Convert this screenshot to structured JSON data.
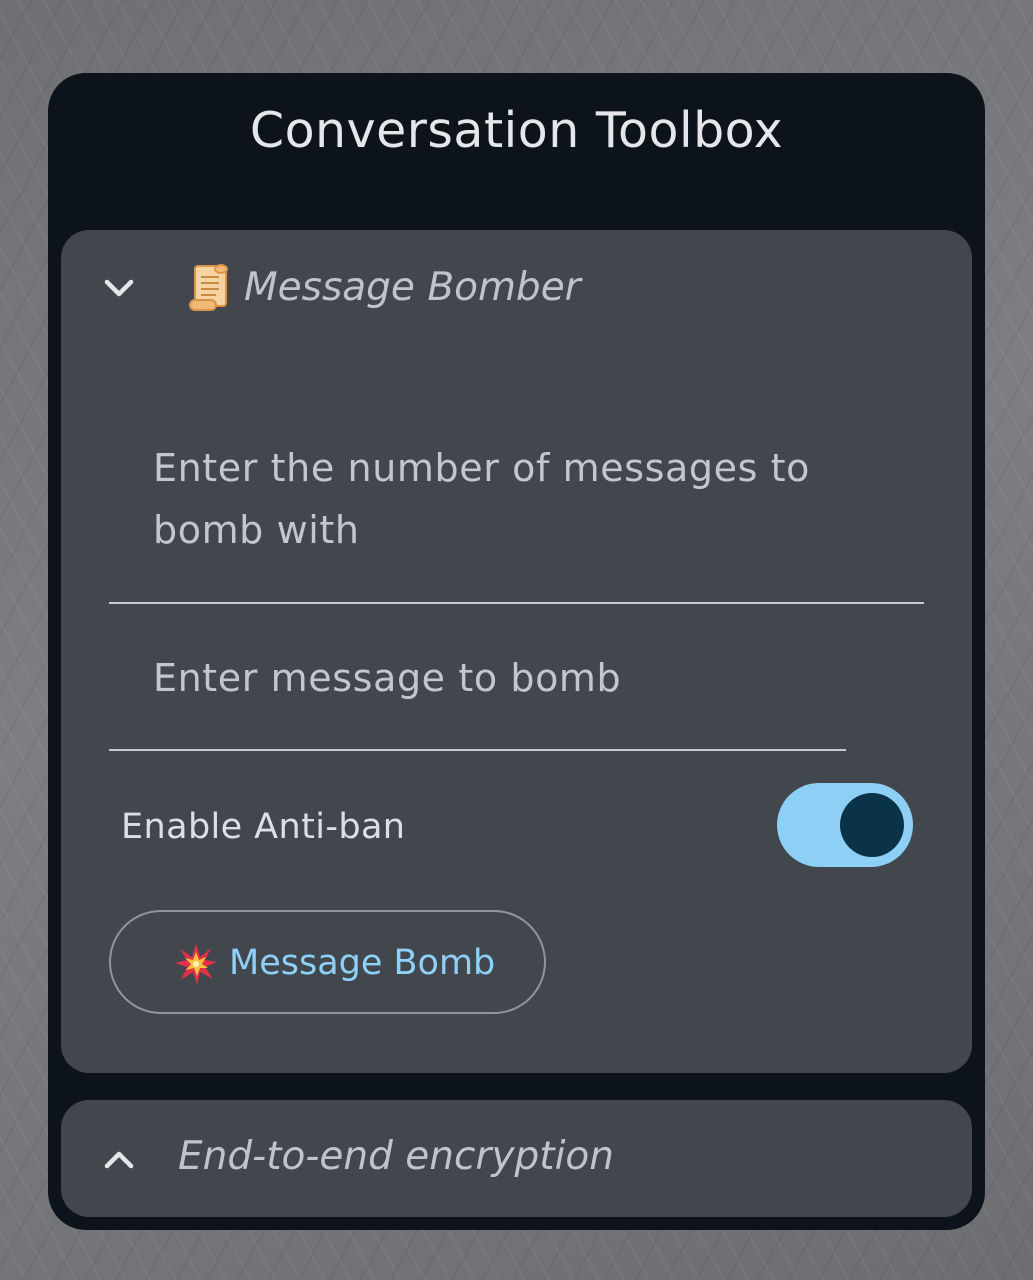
{
  "panel": {
    "title": "Conversation Toolbox"
  },
  "message_bomber": {
    "title": "Message Bomber",
    "expanded": true,
    "header_icon": "scroll-icon",
    "count_field": {
      "placeholder": "Enter the number of messages to bomb with",
      "value": ""
    },
    "message_field": {
      "placeholder": "Enter message to bomb",
      "value": ""
    },
    "anti_ban": {
      "label": "Enable Anti-ban",
      "enabled": true
    },
    "bomb_button": {
      "label": "Message Bomb",
      "icon": "collision-icon"
    }
  },
  "encryption": {
    "title": "End-to-end encryption",
    "expanded": false
  },
  "colors": {
    "panel_background": "#0c131a",
    "card_background": "#41474d",
    "accent": "#8ecff6",
    "switch_thumb": "#0a3348"
  }
}
